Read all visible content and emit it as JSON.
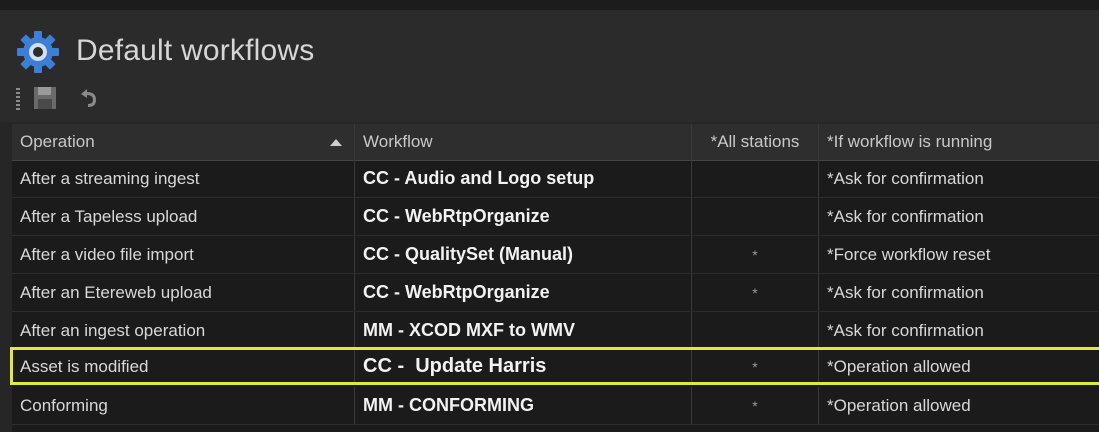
{
  "window": {
    "title": "Default workflows",
    "icon": "gear-icon"
  },
  "toolbar": {
    "buttons": [
      {
        "icon": "save-icon"
      },
      {
        "icon": "undo-icon"
      }
    ]
  },
  "table": {
    "columns": [
      "Operation",
      "Workflow",
      "*All stations",
      "*If workflow is running"
    ],
    "sort_column": "Operation",
    "sort_direction": "ascending",
    "rows": [
      {
        "operation": "After a streaming ingest",
        "workflow": "CC - Audio and Logo setup",
        "all_stations": "",
        "if_running": "*Ask for confirmation"
      },
      {
        "operation": "After a Tapeless upload",
        "workflow": "CC - WebRtpOrganize",
        "all_stations": "",
        "if_running": "*Ask for confirmation"
      },
      {
        "operation": "After a video file import",
        "workflow": "CC - QualitySet (Manual)",
        "all_stations": "*",
        "if_running": "*Force workflow reset"
      },
      {
        "operation": "After an Etereweb upload",
        "workflow": "CC - WebRtpOrganize",
        "all_stations": "*",
        "if_running": "*Ask for confirmation"
      },
      {
        "operation": "After an ingest operation",
        "workflow": "MM - XCOD MXF to WMV",
        "all_stations": "",
        "if_running": "*Ask for confirmation"
      },
      {
        "operation": "Asset is modified",
        "workflow": "CC -  Update Harris",
        "all_stations": "*",
        "if_running": "*Operation allowed",
        "highlighted": true
      },
      {
        "operation": "Conforming",
        "workflow": "MM - CONFORMING",
        "all_stations": "*",
        "if_running": "*Operation allowed"
      }
    ]
  },
  "colors": {
    "background": "#262626",
    "grid_background": "#1b1b1b",
    "highlight_border": "#e1ea3c",
    "gear_blue": "#3d7fd6"
  }
}
